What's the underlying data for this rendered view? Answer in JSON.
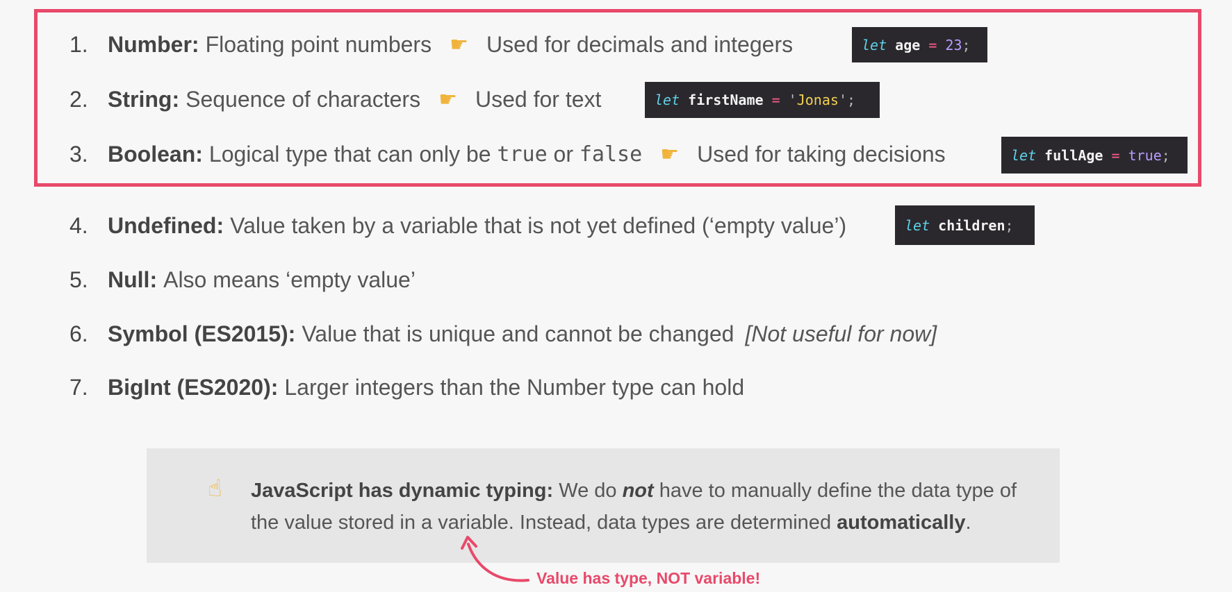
{
  "types": [
    {
      "number": "1.",
      "term": "Number:",
      "description": "Floating point numbers",
      "usage": "Used for decimals and integers",
      "code": [
        {
          "t": "kw",
          "v": "let"
        },
        {
          "t": "id",
          "v": " age "
        },
        {
          "t": "op",
          "v": "="
        },
        {
          "t": "numv",
          "v": " 23"
        },
        {
          "t": "punc",
          "v": ";"
        }
      ]
    },
    {
      "number": "2.",
      "term": "String:",
      "description": "Sequence of characters",
      "usage": "Used for text",
      "code": [
        {
          "t": "kw",
          "v": "let"
        },
        {
          "t": "id",
          "v": " firstName "
        },
        {
          "t": "op",
          "v": "="
        },
        {
          "t": "punc",
          "v": " '"
        },
        {
          "t": "str",
          "v": "Jonas"
        },
        {
          "t": "punc",
          "v": "';"
        }
      ]
    },
    {
      "number": "3.",
      "term": "Boolean:",
      "description_before": "Logical type that can only be",
      "value_true": "true",
      "connector": "or",
      "value_false": "false",
      "usage": "Used for taking decisions",
      "code": [
        {
          "t": "kw",
          "v": "let"
        },
        {
          "t": "id",
          "v": " fullAge "
        },
        {
          "t": "op",
          "v": "="
        },
        {
          "t": "numv",
          "v": " true"
        },
        {
          "t": "punc",
          "v": ";"
        }
      ]
    },
    {
      "number": "4.",
      "term": "Undefined:",
      "description": "Value taken by a variable that is not yet defined (‘empty value’)",
      "code": [
        {
          "t": "kw",
          "v": "let"
        },
        {
          "t": "id",
          "v": " children"
        },
        {
          "t": "punc",
          "v": ";"
        }
      ]
    },
    {
      "number": "5.",
      "term": "Null:",
      "description": "Also means ‘empty value’"
    },
    {
      "number": "6.",
      "term": "Symbol (ES2015):",
      "description": "Value that is unique and cannot be changed",
      "aside": "[Not useful for now]"
    },
    {
      "number": "7.",
      "term": "BigInt (ES2020):",
      "description": "Larger integers than the Number type can hold"
    }
  ],
  "pointer_icon": "pointing-hand-icon",
  "note": {
    "icon": "index-pointing-up-icon",
    "title": "JavaScript has dynamic typing:",
    "text_1": "We do",
    "emphasis": "not",
    "text_2": "have to manually define the data type of the value stored in a variable. Instead, data types are determined",
    "strong": "automatically",
    "end": "."
  },
  "callout": "Value has type, NOT variable!",
  "colors": {
    "highlight": "#e8496a",
    "code_bg": "#2a282d",
    "keyword": "#5fd1e8",
    "operator": "#ff5c8a",
    "number": "#b89cff",
    "string": "#f2d150"
  }
}
